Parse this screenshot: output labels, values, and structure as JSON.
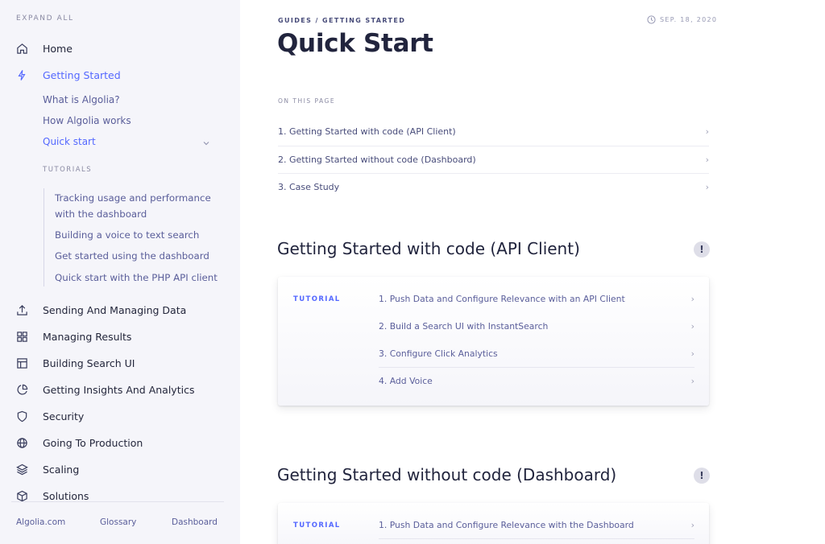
{
  "sidebar": {
    "expand_all": "EXPAND ALL",
    "home": "Home",
    "getting_started": "Getting Started",
    "sub_items": [
      "What is Algolia?",
      "How Algolia works",
      "Quick start"
    ],
    "tutorials_heading": "TUTORIALS",
    "tutorials": [
      "Tracking usage and performance",
      "with the dashboard",
      "Building a voice to text search",
      "Get started using the dashboard",
      "Quick start with the PHP API client"
    ],
    "nav": [
      {
        "label": "Sending And Managing Data",
        "icon": "upload-icon"
      },
      {
        "label": "Managing Results",
        "icon": "grid-icon"
      },
      {
        "label": "Building Search UI",
        "icon": "layout-icon"
      },
      {
        "label": "Getting Insights And Analytics",
        "icon": "pie-chart-icon"
      },
      {
        "label": "Security",
        "icon": "shield-icon"
      },
      {
        "label": "Going To Production",
        "icon": "globe-icon"
      },
      {
        "label": "Scaling",
        "icon": "layers-icon"
      },
      {
        "label": "Solutions",
        "icon": "box-icon"
      }
    ],
    "footer": [
      "Algolia.com",
      "Glossary",
      "Dashboard"
    ]
  },
  "main": {
    "breadcrumb": "GUIDES / GETTING STARTED",
    "date": "SEP. 18, 2020",
    "title": "Quick Start",
    "on_this_page": "ON THIS PAGE",
    "toc": [
      "1. Getting Started with code (API Client)",
      "2. Getting Started without code (Dashboard)",
      "3. Case Study"
    ],
    "sections": [
      {
        "title": "Getting Started with code (API Client)",
        "alert": "!",
        "tag": "TUTORIAL",
        "items": [
          "1. Push Data and Configure Relevance with an API Client",
          "2. Build a Search UI with InstantSearch",
          "3. Configure Click Analytics",
          "4. Add Voice"
        ]
      },
      {
        "title": "Getting Started without code (Dashboard)",
        "alert": "!",
        "tag": "TUTORIAL",
        "items": [
          "1. Push Data and Configure Relevance with the Dashboard"
        ]
      }
    ]
  },
  "colors": {
    "accent": "#5468ff",
    "text": "#21243d",
    "muted": "#5a5e9a",
    "sidebar_bg": "#f5f5fa"
  }
}
